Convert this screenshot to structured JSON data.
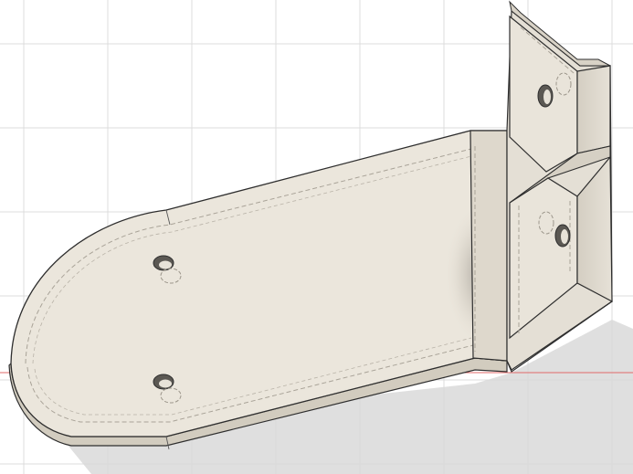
{
  "viewport": {
    "background": "#ffffff",
    "grid_color": "#dcdcdc",
    "axis_color": "#e06a6a"
  },
  "model": {
    "face_light": "#ebe6dc",
    "face_mid": "#ddd7cb",
    "face_dark": "#c8c1b4",
    "edge_color": "#2e2e2e",
    "hidden_edge_color": "#a9a398",
    "shadow_color": "#d6d6d6"
  }
}
